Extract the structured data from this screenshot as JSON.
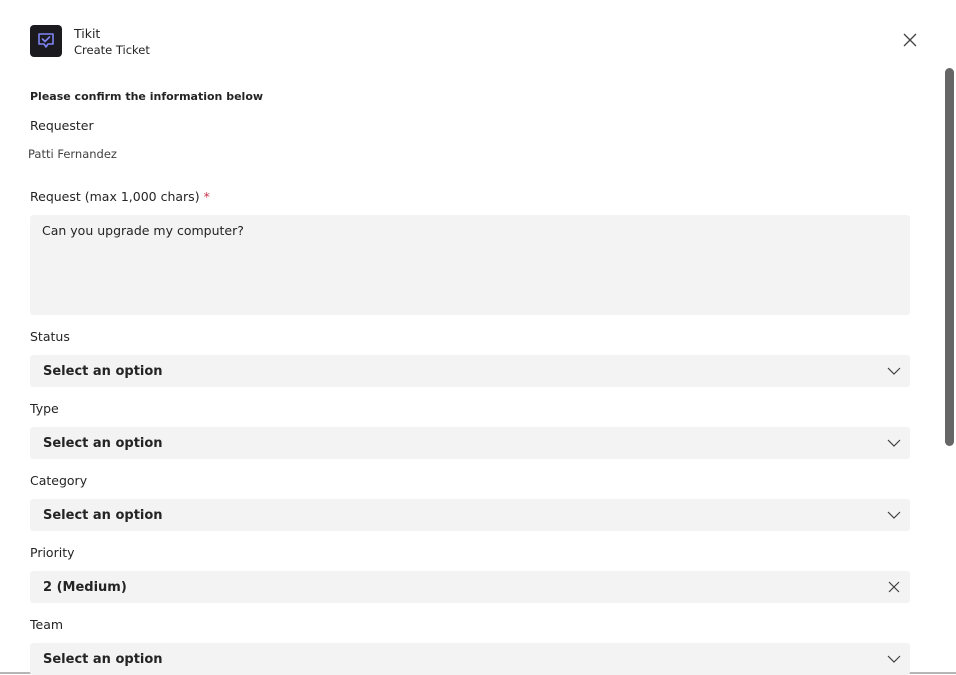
{
  "app": {
    "name": "Tikit",
    "subtitle": "Create Ticket"
  },
  "form": {
    "confirm_text": "Please confirm the information below",
    "requester_label": "Requester",
    "requester_value": "Patti Fernandez",
    "request_label": "Request (max 1,000 chars)",
    "required_mark": "*",
    "request_value": "Can you upgrade my computer?",
    "status_label": "Status",
    "status_value": "Select an option",
    "type_label": "Type",
    "type_value": "Select an option",
    "category_label": "Category",
    "category_value": "Select an option",
    "priority_label": "Priority",
    "priority_value": "2 (Medium)",
    "team_label": "Team",
    "team_value": "Select an option"
  },
  "icons": {
    "app": "tikit-logo-icon",
    "close": "close-icon",
    "dropdown": "chevron-down-icon",
    "clear": "clear-icon"
  },
  "colors": {
    "app_icon_bg": "#1b1a1f",
    "app_icon_accent": "#7f85f5",
    "field_bg": "#f3f3f3",
    "required": "#c4314b"
  }
}
